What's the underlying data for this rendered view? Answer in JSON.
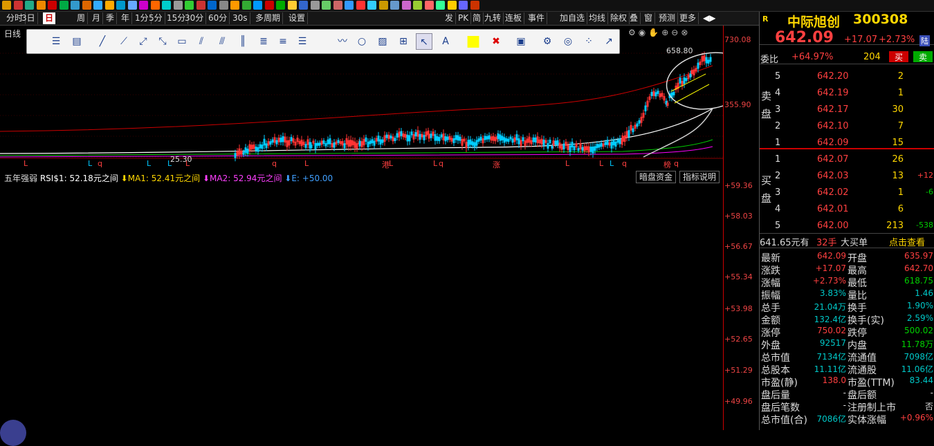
{
  "menubar": {
    "items": [
      "分时",
      "3日",
      "日",
      "周",
      "月",
      "季",
      "年",
      "1分",
      "5分",
      "15分",
      "30分",
      "60分",
      "30s",
      "多周期",
      "设置"
    ],
    "right_items": [
      "发",
      "PK",
      "简",
      "九转",
      "连板",
      "事件",
      "加自选",
      "均线",
      "除权",
      "叠",
      "窗",
      "预测",
      "更多"
    ]
  },
  "chart": {
    "upper_label": "日线",
    "upper_axis": [
      "730.08",
      "658.80",
      "355.90",
      "25.30"
    ],
    "markers": [
      "L",
      "L",
      "q",
      "L",
      "L",
      "L",
      "q",
      "L",
      "港",
      "L",
      "L",
      "q",
      "涨",
      "L",
      "L",
      "L",
      "q",
      "榜",
      "q",
      "财"
    ],
    "indicator_header": {
      "name": "五年强弱",
      "rsi": "RSI$1: 52.18元之间",
      "ma1": "MA1: 52.41元之间",
      "ma2": "MA2: 52.94元之间",
      "e": "E: +50.00"
    },
    "lower_buttons": [
      "暗盘资金",
      "指标说明"
    ],
    "lower_axis": [
      "+59.36",
      "+58.03",
      "+56.67",
      "+55.34",
      "+53.98",
      "+52.65",
      "+51.29",
      "+49.96"
    ]
  },
  "quote": {
    "name": "中际旭创",
    "code": "300308",
    "price": "642.09",
    "change": "+17.07",
    "pct": "+2.73%",
    "tag": "陆",
    "r_badge": "R",
    "weibi_label": "委比",
    "weibi": "+64.97%",
    "weicha": "204",
    "buy_btn": "买",
    "sell_btn": "卖",
    "sell_label": "卖盘",
    "buy_label": "买盘",
    "sells": [
      {
        "lv": "5",
        "p": "642.20",
        "v": "2",
        "d": ""
      },
      {
        "lv": "4",
        "p": "642.19",
        "v": "1",
        "d": ""
      },
      {
        "lv": "3",
        "p": "642.17",
        "v": "30",
        "d": ""
      },
      {
        "lv": "2",
        "p": "642.10",
        "v": "7",
        "d": ""
      },
      {
        "lv": "1",
        "p": "642.09",
        "v": "15",
        "d": ""
      }
    ],
    "buys": [
      {
        "lv": "1",
        "p": "642.07",
        "v": "26",
        "d": ""
      },
      {
        "lv": "2",
        "p": "642.03",
        "v": "13",
        "d": "+12"
      },
      {
        "lv": "3",
        "p": "642.02",
        "v": "1",
        "d": "-6"
      },
      {
        "lv": "4",
        "p": "642.01",
        "v": "6",
        "d": ""
      },
      {
        "lv": "5",
        "p": "642.00",
        "v": "213",
        "d": "-538"
      }
    ],
    "bigbuy": {
      "price": "641.65元有",
      "qty": "32手",
      "label": "大买单",
      "link": "点击查看"
    },
    "stats": [
      [
        "最新",
        "642.09",
        "开盘",
        "635.97"
      ],
      [
        "涨跌",
        "+17.07",
        "最高",
        "642.70"
      ],
      [
        "涨幅",
        "+2.73%",
        "最低",
        "618.75"
      ],
      [
        "振幅",
        "3.83%",
        "量比",
        "1.46"
      ],
      [
        "总手",
        "21.04万",
        "换手",
        "1.90%"
      ],
      [
        "金额",
        "132.4亿",
        "换手(实)",
        "2.59%"
      ],
      [
        "涨停",
        "750.02",
        "跌停",
        "500.02"
      ],
      [
        "外盘",
        "92517",
        "内盘",
        "11.78万"
      ],
      [
        "总市值",
        "7134亿",
        "流通值",
        "7098亿"
      ],
      [
        "总股本",
        "11.11亿",
        "流通股",
        "11.06亿"
      ],
      [
        "市盈(静)",
        "138.0",
        "市盈(TTM)",
        "83.44"
      ],
      [
        "盘后量",
        "-",
        "盘后额",
        "-"
      ],
      [
        "盘后笔数",
        "-",
        "注册制上市",
        "否"
      ],
      [
        "总市值(合)",
        "7086亿",
        "实体涨幅",
        "+0.96%"
      ]
    ]
  }
}
